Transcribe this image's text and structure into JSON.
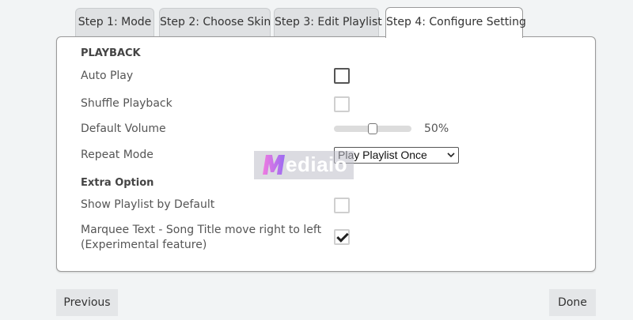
{
  "tabs": [
    {
      "label": "Step 1: Mode"
    },
    {
      "label": "Step 2: Choose Skin"
    },
    {
      "label": "Step 3: Edit Playlist"
    },
    {
      "label": "Step 4: Configure Setting",
      "active": true
    }
  ],
  "playback": {
    "heading": "PLAYBACK",
    "auto_play": {
      "label": "Auto Play",
      "checked": false
    },
    "shuffle": {
      "label": "Shuffle Playback",
      "checked": false
    },
    "volume": {
      "label": "Default Volume",
      "value": 50,
      "value_text": "50%"
    },
    "repeat": {
      "label": "Repeat Mode",
      "selected": "Play Playlist Once"
    }
  },
  "extra": {
    "heading": "Extra Option",
    "show_playlist": {
      "label": "Show Playlist by Default",
      "checked": false
    },
    "marquee": {
      "label_line1": "Marquee Text - Song Title move right to left",
      "label_line2": "(Experimental feature)",
      "checked": true
    }
  },
  "watermark": {
    "text": "ediaio"
  },
  "buttons": {
    "previous": "Previous",
    "done": "Done"
  },
  "colors": {
    "background": "#f2f4f5",
    "panel": "#ffffff",
    "tab_inactive": "#dfe1e3",
    "button": "#e4e6e8"
  }
}
